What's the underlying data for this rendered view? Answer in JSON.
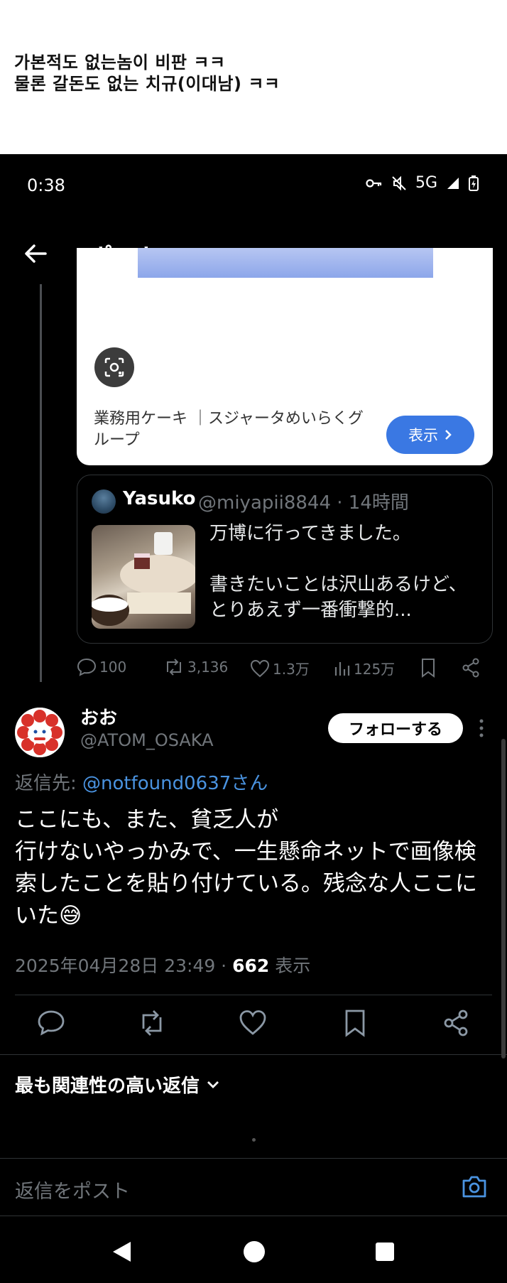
{
  "caption": {
    "line1": "가본적도 없는놈이 비판 ㅋㅋ",
    "line2": "물론 갈돈도 없는 치규(이대남) ㅋㅋ"
  },
  "status_bar": {
    "time": "0:38",
    "network": "5G"
  },
  "app_bar": {
    "title": "ポスト"
  },
  "ad_card": {
    "text": "業務用ケーキ ｜スジャータめいらくグループ",
    "button_label": "表示"
  },
  "quoted_post": {
    "name": "Yasuko",
    "handle": "@miyapii8844 · 14時間",
    "text": "万博に行ってきました。\n\n書きたいことは沢山あるけど、とりあえず一番衝撃的..."
  },
  "quoted_actions": {
    "replies": "100",
    "reposts": "3,136",
    "likes": "1.3万",
    "views": "125万"
  },
  "post": {
    "name": "おお",
    "handle": "@ATOM_OSAKA",
    "follow_label": "フォローする",
    "reply_to_prefix": "返信先:",
    "reply_to_mention": "@notfound0637さん",
    "body": "ここにも、また、貧乏人が\n行けないやっかみで、一生懸命ネットで画像検索したことを貼り付けている。残念な人ここにいた😅",
    "date": "2025年04月28日 23:49 · ",
    "views_count": "662",
    "views_label": "表示"
  },
  "relevant_replies_label": "最も関連性の高い返信",
  "reply_box": {
    "placeholder": "返信をポスト"
  },
  "colors": {
    "accent": "#4a93e0",
    "button_blue": "#3a78e3",
    "muted": "#71767b"
  }
}
